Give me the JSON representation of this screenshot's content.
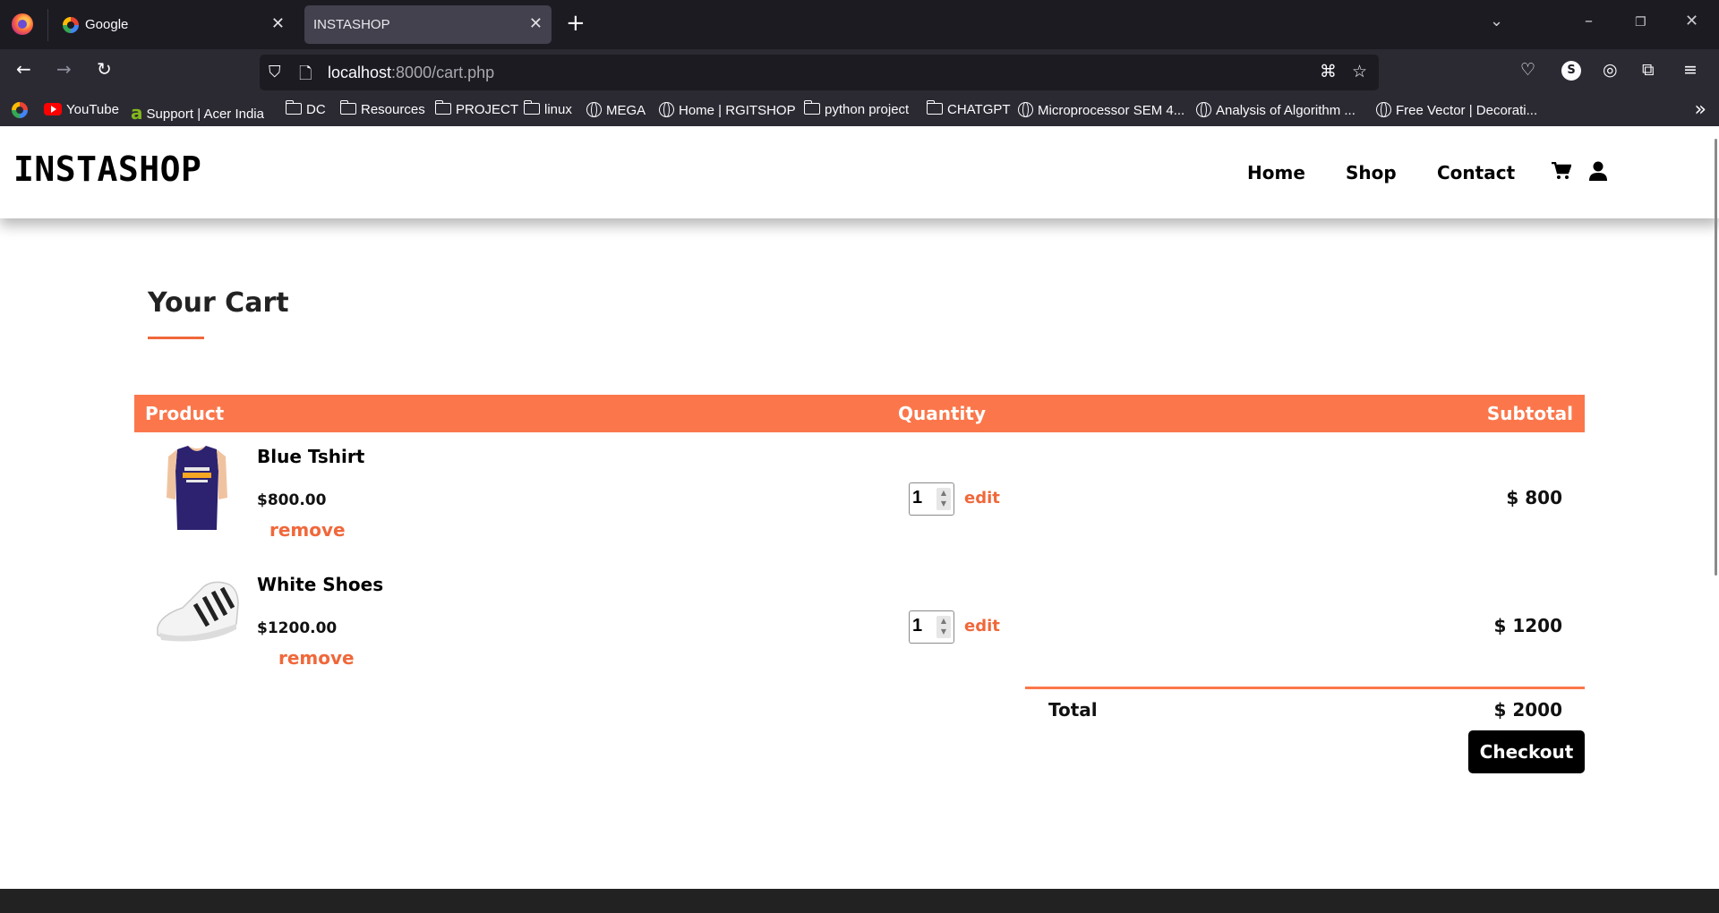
{
  "browser": {
    "tabs": [
      {
        "title": "Google",
        "active": false
      },
      {
        "title": "INSTASHOP",
        "active": true
      }
    ],
    "url": {
      "host": "localhost",
      "rest": ":8000/cart.php"
    },
    "bookmarks": [
      {
        "label": "YouTube",
        "icon": "youtube-icon"
      },
      {
        "label": "Support | Acer India",
        "icon": "acer-icon"
      },
      {
        "label": "DC",
        "icon": "folder-icon"
      },
      {
        "label": "Resources",
        "icon": "folder-icon"
      },
      {
        "label": "PROJECT",
        "icon": "folder-icon"
      },
      {
        "label": "linux",
        "icon": "folder-icon"
      },
      {
        "label": "MEGA",
        "icon": "globe-icon"
      },
      {
        "label": "Home | RGITSHOP",
        "icon": "globe-icon"
      },
      {
        "label": "python project",
        "icon": "folder-icon"
      },
      {
        "label": "CHATGPT",
        "icon": "folder-icon"
      },
      {
        "label": "Microprocessor SEM 4...",
        "icon": "globe-icon"
      },
      {
        "label": "Analysis of Algorithm ...",
        "icon": "globe-icon"
      },
      {
        "label": "Free Vector | Decorati...",
        "icon": "globe-icon"
      }
    ],
    "profile_initial": "S"
  },
  "site": {
    "brand": "INSTASHOP",
    "menu": [
      "Home",
      "Shop",
      "Contact"
    ]
  },
  "cart": {
    "title": "Your Cart",
    "headers": {
      "product": "Product",
      "quantity": "Quantity",
      "subtotal": "Subtotal"
    },
    "items": [
      {
        "name": "Blue Tshirt",
        "price": "$800.00",
        "remove": "remove",
        "quantity": "1",
        "edit": "edit",
        "subtotal": "$ 800"
      },
      {
        "name": "White Shoes",
        "price": "$1200.00",
        "remove": "remove",
        "quantity": "1",
        "edit": "edit",
        "subtotal": "$ 1200"
      }
    ],
    "total_label": "Total",
    "total_value": "$ 2000",
    "checkout": "Checkout"
  },
  "colors": {
    "accent": "#fb774b",
    "brand_text": "#000000",
    "browser_bg": "#1c1b22"
  }
}
